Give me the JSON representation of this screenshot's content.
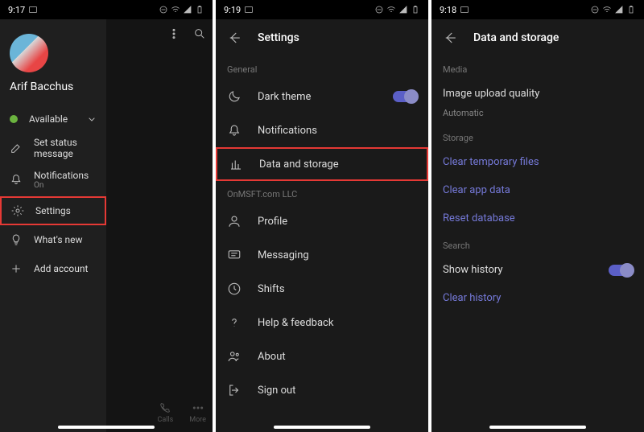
{
  "screen1": {
    "time": "9:17",
    "username": "Arif Bacchus",
    "status": "Available",
    "items": {
      "setStatus": "Set status message",
      "notifications": "Notifications",
      "notificationsSub": "On",
      "settings": "Settings",
      "whatsNew": "What's new",
      "addAccount": "Add account"
    },
    "bottom": {
      "calls": "Calls",
      "more": "More"
    }
  },
  "screen2": {
    "time": "9:19",
    "title": "Settings",
    "sections": {
      "general": "General",
      "org": "OnMSFT.com LLC"
    },
    "items": {
      "darkTheme": "Dark theme",
      "notifications": "Notifications",
      "dataStorage": "Data and storage",
      "profile": "Profile",
      "messaging": "Messaging",
      "shifts": "Shifts",
      "help": "Help & feedback",
      "about": "About",
      "signOut": "Sign out"
    }
  },
  "screen3": {
    "time": "9:18",
    "title": "Data and storage",
    "sections": {
      "media": "Media",
      "storage": "Storage",
      "search": "Search"
    },
    "items": {
      "uploadQuality": "Image upload quality",
      "uploadQualitySub": "Automatic",
      "clearTemp": "Clear temporary files",
      "clearAppData": "Clear app data",
      "resetDb": "Reset database",
      "showHistory": "Show history",
      "clearHistory": "Clear history"
    }
  }
}
